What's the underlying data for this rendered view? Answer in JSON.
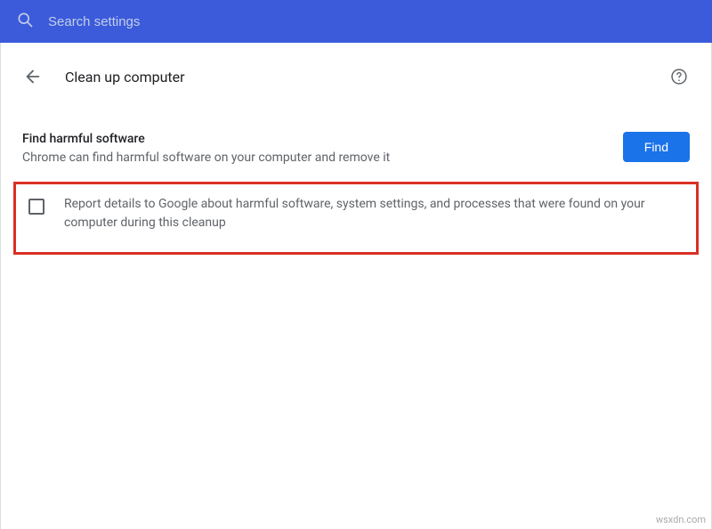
{
  "search": {
    "placeholder": "Search settings"
  },
  "header": {
    "title": "Clean up computer"
  },
  "section": {
    "title": "Find harmful software",
    "description": "Chrome can find harmful software on your computer and remove it",
    "button_label": "Find"
  },
  "option": {
    "checkbox_label": "Report details to Google about harmful software, system settings, and processes that were found on your computer during this cleanup",
    "checked": false
  },
  "watermark": "wsxdn.com",
  "colors": {
    "header_bg": "#3b5bdb",
    "primary_button": "#1a73e8",
    "highlight_border": "#d93025",
    "text_primary": "#202124",
    "text_secondary": "#5f6368"
  }
}
